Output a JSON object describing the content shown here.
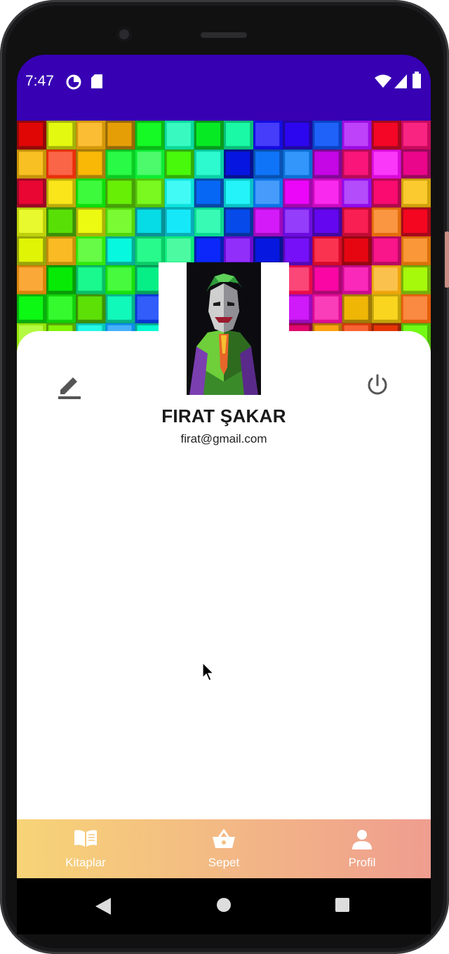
{
  "status_bar": {
    "time": "7:47",
    "left_icons": [
      "data-saver-icon",
      "sd-card-icon"
    ],
    "right_icons": [
      "wifi-icon",
      "signal-icon",
      "battery-icon"
    ],
    "background_color": "#3700b3"
  },
  "profile": {
    "name": "FIRAT ŞAKAR",
    "email": "firat@gmail.com",
    "edit_icon": "edit-pencil-icon",
    "logout_icon": "power-icon"
  },
  "bottom_nav": {
    "items": [
      {
        "label": "Kitaplar",
        "icon": "book-icon"
      },
      {
        "label": "Sepet",
        "icon": "basket-icon"
      },
      {
        "label": "Profil",
        "icon": "person-icon"
      }
    ],
    "gradient": [
      "#f7d477",
      "#ef9d8f"
    ]
  },
  "system_nav": {
    "buttons": [
      "back",
      "home",
      "recents"
    ]
  }
}
